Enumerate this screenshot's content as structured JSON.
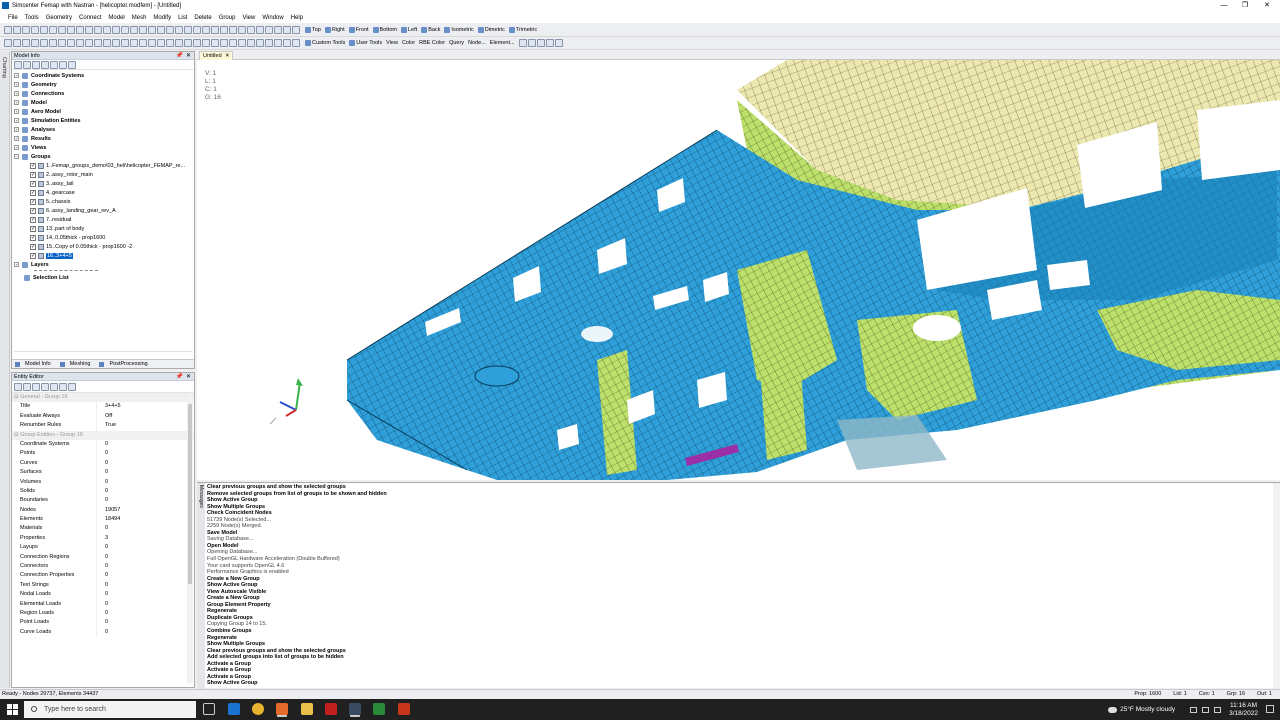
{
  "window": {
    "title": "Simcenter Femap with Nastran - [helicopter.modfem] - [Untitled]",
    "min": "—",
    "max": "❐",
    "close": "✕"
  },
  "menu": [
    "File",
    "Tools",
    "Geometry",
    "Connect",
    "Model",
    "Mesh",
    "Modify",
    "List",
    "Delete",
    "Group",
    "View",
    "Window",
    "Help"
  ],
  "toolbar1": {
    "views": [
      "Top",
      "Right",
      "Front",
      "Bottom",
      "Left",
      "Back",
      "Isometric",
      "Dimetric",
      "Trimetric"
    ]
  },
  "toolbar2": {
    "labels": [
      "Custom Tools",
      "User Tools",
      "View",
      "Color",
      "RBE Color",
      "Query",
      "Node...",
      "Element..."
    ]
  },
  "left_strip": "Charting",
  "model_info": {
    "title": "Model Info",
    "pin": "📌",
    "close": "✕",
    "tree": [
      "Coordinate Systems",
      "Geometry",
      "Connections",
      "Model",
      "Aero Model",
      "Simulation Entities",
      "Analyses",
      "Results",
      "Views",
      "Groups"
    ],
    "groups": [
      "1..Femap_groups_demo\\03_heli\\helicopter_FEMAP_re...",
      "2..assy_rotor_main",
      "3..assy_tail",
      "4..gearcase",
      "5..chassis",
      "6..assy_landing_gear_rev_A",
      "7..residual",
      "13..part of body",
      "14..0.05thick - prop1600",
      "15..Copy of 0.05thick - prop1600 -2",
      "16..3+4+5"
    ],
    "after": [
      "Layers",
      "Selection List"
    ],
    "tabs": [
      "Model Info",
      "Meshing",
      "PostProcessing"
    ]
  },
  "entity_editor": {
    "title": "Entity Editor",
    "sections": [
      "General - Group 16",
      "Group Entities - Group 16"
    ],
    "general": [
      {
        "k": "Title",
        "v": "3+4+5"
      },
      {
        "k": "Evaluate Always",
        "v": "Off"
      },
      {
        "k": "Renumber Rules",
        "v": "True"
      }
    ],
    "entities": [
      {
        "k": "Coordinate Systems",
        "v": "0"
      },
      {
        "k": "Points",
        "v": "0"
      },
      {
        "k": "Curves",
        "v": "0"
      },
      {
        "k": "Surfaces",
        "v": "0"
      },
      {
        "k": "Volumes",
        "v": "0"
      },
      {
        "k": "Solids",
        "v": "0"
      },
      {
        "k": "Boundaries",
        "v": "0"
      },
      {
        "k": "Nodes",
        "v": "19057"
      },
      {
        "k": "Elements",
        "v": "18494"
      },
      {
        "k": "Materials",
        "v": "0"
      },
      {
        "k": "Properties",
        "v": "3"
      },
      {
        "k": "Layups",
        "v": "0"
      },
      {
        "k": "Connection Regions",
        "v": "0"
      },
      {
        "k": "Connectors",
        "v": "0"
      },
      {
        "k": "Connection Properties",
        "v": "0"
      },
      {
        "k": "Text Strings",
        "v": "0"
      },
      {
        "k": "Nodal Loads",
        "v": "0"
      },
      {
        "k": "Elemental Loads",
        "v": "0"
      },
      {
        "k": "Region Loads",
        "v": "0"
      },
      {
        "k": "Point Loads",
        "v": "0"
      },
      {
        "k": "Curve Loads",
        "v": "0"
      }
    ]
  },
  "document_tab": "Untitled",
  "viewport": {
    "info": [
      "V: 1",
      "L: 1",
      "C: 1",
      "G: 16"
    ],
    "colors": {
      "blue": "#2e9fd8",
      "green": "#bde06a",
      "cream": "#ede8b0",
      "dark": "#0a3c5a",
      "magenta": "#9b2fa8"
    }
  },
  "messages": [
    {
      "t": "Clear previous groups and show the selected groups",
      "b": true
    },
    {
      "t": "Remove selected groups from list of groups to be shown and hidden",
      "b": true
    },
    {
      "t": "Show Active Group",
      "b": true
    },
    {
      "t": "Show Multiple Groups",
      "b": true
    },
    {
      "t": "Check Coincident Nodes",
      "b": true
    },
    {
      "t": "51739 Node(s) Selected...",
      "b": false
    },
    {
      "t": "2259 Node(s) Merged.",
      "b": false
    },
    {
      "t": "Save Model",
      "b": true
    },
    {
      "t": "Saving Database...",
      "b": false
    },
    {
      "t": "Open Model",
      "b": true
    },
    {
      "t": "Opening Database...",
      "b": false
    },
    {
      "t": "Full OpenGL Hardware Acceleration (Double Buffered)",
      "b": false
    },
    {
      "t": "Your card supports OpenGL 4.6",
      "b": false
    },
    {
      "t": "Performance Graphics is enabled",
      "b": false
    },
    {
      "t": "Create a New Group",
      "b": true
    },
    {
      "t": "Show Active Group",
      "b": true
    },
    {
      "t": "View Autoscale Visible",
      "b": true
    },
    {
      "t": "Create a New Group",
      "b": true
    },
    {
      "t": "Group Element Property",
      "b": true
    },
    {
      "t": "Regenerate",
      "b": true
    },
    {
      "t": "Duplicate Groups",
      "b": true
    },
    {
      "t": "Copying Group 14 to 15.",
      "b": false
    },
    {
      "t": "Combine Groups",
      "b": true
    },
    {
      "t": "Regenerate",
      "b": true
    },
    {
      "t": "Show Multiple Groups",
      "b": true
    },
    {
      "t": "Clear previous groups and show the selected groups",
      "b": true
    },
    {
      "t": "Add selected groups into list of groups to be hidden",
      "b": true
    },
    {
      "t": "Activate a Group",
      "b": true
    },
    {
      "t": "Activate a Group",
      "b": true
    },
    {
      "t": "Activate a Group",
      "b": true
    },
    {
      "t": "Show Active Group",
      "b": true
    }
  ],
  "messages_strip": "Messages",
  "status": {
    "left": "Ready - Nodes 29737, Elements 34437",
    "right": [
      "Prop: 1600",
      "Lid: 1",
      "Csn: 1",
      "Grp: 16",
      "Out: 1"
    ]
  },
  "taskbar": {
    "search": "Type here to search",
    "weather": "25°F  Mostly cloudy",
    "time": "11:16 AM",
    "date": "3/18/2022"
  }
}
